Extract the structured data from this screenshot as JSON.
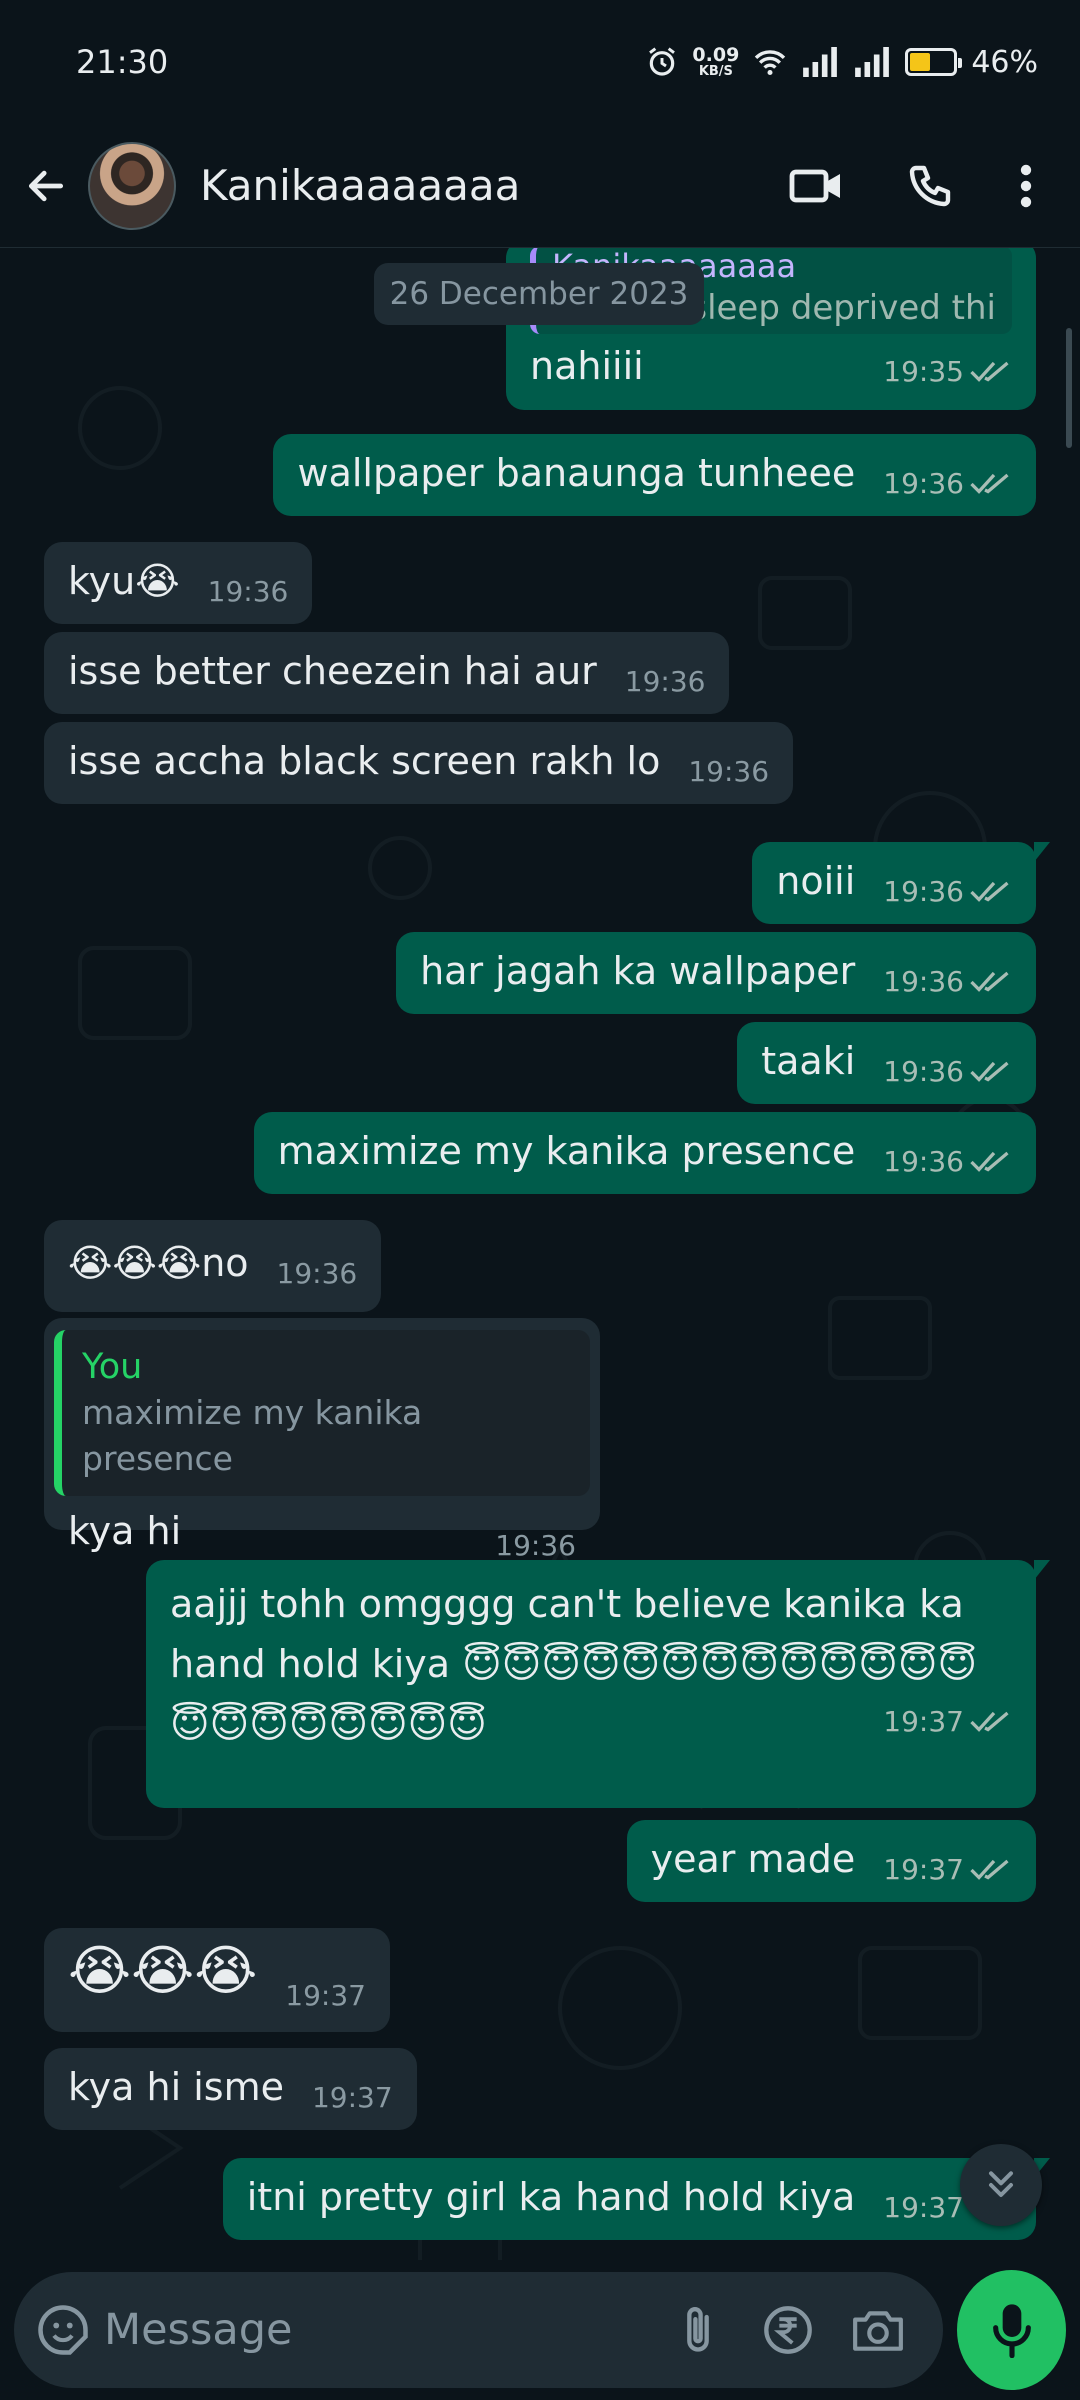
{
  "status_bar": {
    "time": "21:30",
    "net_speed_value": "0.09",
    "net_speed_unit": "KB/S",
    "battery_percent": "46%",
    "battery_level": 0.46
  },
  "header": {
    "contact_name": "Kanikaaaaaaaa",
    "icons": [
      "back-arrow-icon",
      "video-call-icon",
      "voice-call-icon",
      "more-options-icon"
    ]
  },
  "chat": {
    "date_label": "26 December 2023",
    "partial_quote_name": "Kanikaaaaaaaa",
    "partial_quote_text": "I sleep deprived thi",
    "messages": [
      {
        "dir": "out",
        "text": "nahiiii",
        "time": "19:35"
      },
      {
        "dir": "out",
        "text": "wallpaper banaunga tunheee",
        "time": "19:36"
      },
      {
        "dir": "in",
        "text": "kyu😭",
        "time": "19:36"
      },
      {
        "dir": "in",
        "text": "isse better cheezein hai aur",
        "time": "19:36"
      },
      {
        "dir": "in",
        "text": "isse accha black screen rakh lo",
        "time": "19:36"
      },
      {
        "dir": "out",
        "text": "noiii",
        "time": "19:36"
      },
      {
        "dir": "out",
        "text": "har jagah ka wallpaper",
        "time": "19:36"
      },
      {
        "dir": "out",
        "text": "taaki",
        "time": "19:36"
      },
      {
        "dir": "out",
        "text": "maximize my kanika presence",
        "time": "19:36"
      },
      {
        "dir": "in",
        "text": "😭😭😭no",
        "time": "19:36"
      },
      {
        "dir": "in",
        "reply_who": "You",
        "reply_text": "maximize my kanika presence",
        "text": "kya hi",
        "time": "19:36"
      },
      {
        "dir": "out",
        "text": "aajjj tohh omgggg can't believe kanika ka hand hold kiya 😇😇😇😇😇😇😇😇😇😇😇😇😇😇😇😇😇😇😇😇😇",
        "time": "19:37"
      },
      {
        "dir": "out",
        "text": "year made",
        "time": "19:37"
      },
      {
        "dir": "in",
        "text": "😭😭😭",
        "time": "19:37"
      },
      {
        "dir": "in",
        "text": "kya hi isme",
        "time": "19:37"
      },
      {
        "dir": "out",
        "text": "itni pretty girl ka hand hold kiya",
        "time": "19:37"
      }
    ]
  },
  "composer": {
    "placeholder": "Message",
    "icons": [
      "emoji-icon",
      "attach-icon",
      "rupee-payment-icon",
      "camera-icon",
      "mic-icon"
    ]
  },
  "colors": {
    "background": "#0b141a",
    "incoming_bubble": "#1f2c34",
    "outgoing_bubble": "#005c4b",
    "accent_green": "#21c063",
    "read_tick": "#a8bdb5"
  }
}
